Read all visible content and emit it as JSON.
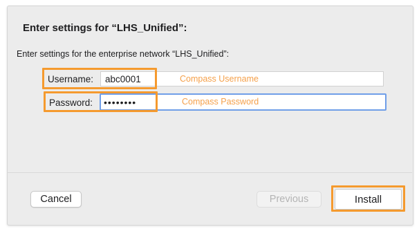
{
  "dialog": {
    "title": "Enter settings for “LHS_Unified”:",
    "subtitle": "Enter settings for the enterprise network “LHS_Unified”:"
  },
  "form": {
    "username": {
      "label": "Username:",
      "value": "abc0001",
      "hint": "Compass Username"
    },
    "password": {
      "label": "Password:",
      "value": "••••••••",
      "hint": "Compass Password"
    }
  },
  "buttons": {
    "cancel": "Cancel",
    "previous": "Previous",
    "install": "Install"
  },
  "colors": {
    "highlight_orange": "#f59a2e",
    "highlight_blue": "#6f9ee8",
    "hint_text": "#f5a04a",
    "dialog_background": "#ececec"
  }
}
